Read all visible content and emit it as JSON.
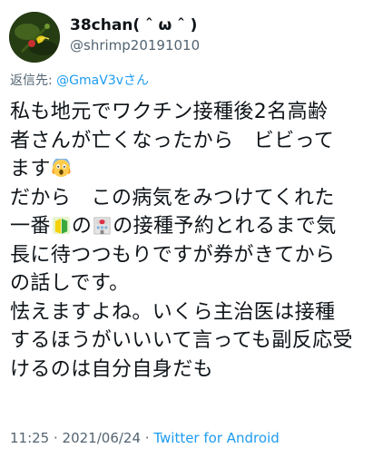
{
  "user": {
    "display_name": "38chan( ˆ ω ˆ )",
    "handle": "@shrimp20191010",
    "avatar_icon": "shrimp-avatar-icon"
  },
  "reply": {
    "prefix": "返信先: ",
    "mention": "@GmaV3vさん"
  },
  "tweet": {
    "lines": [
      "私も地元でワクチン接種後2名高齢",
      "者さんが亡くなったから　ビビって",
      "ます",
      "だから　この病気をみつけてくれた",
      "一番",
      "長に待つつもりですが券がきてから",
      "の話しです。",
      "怯えますよね。いくら主治医は接種",
      "するほうがいいいて言っても副反応受",
      "けるのは自分自身だも"
    ],
    "line5_middle": "の",
    "line5_tail": "の接種予約とれるまで気",
    "emojis": {
      "scared": "scream-face-icon",
      "beginner": "beginner-mark-icon",
      "hospital": "hospital-icon"
    }
  },
  "meta": {
    "time": "11:25",
    "sep1": " · ",
    "date": "2021/06/24",
    "sep2": " · ",
    "source": "Twitter for Android"
  }
}
